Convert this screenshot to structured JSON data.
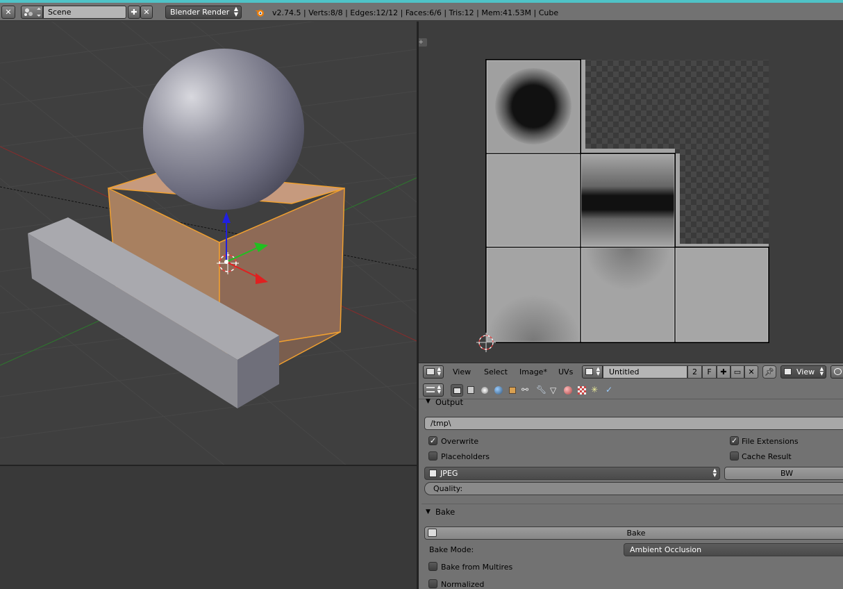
{
  "header": {
    "scene_name": "Scene",
    "render_engine": "Blender Render",
    "info": "v2.74.5 | Verts:8/8 | Edges:12/12 | Faces:6/6 | Tris:12 | Mem:41.53M | Cube"
  },
  "uv_editor": {
    "menus": [
      "View",
      "Select",
      "Image*",
      "UVs"
    ],
    "image_name": "Untitled",
    "users_count": "2",
    "fake_user": "F",
    "view_mode": "View"
  },
  "properties": {
    "output": {
      "title": "Output",
      "path": "/tmp\\",
      "overwrite_label": "Overwrite",
      "overwrite_checked": true,
      "file_extensions_label": "File Extensions",
      "file_extensions_checked": true,
      "placeholders_label": "Placeholders",
      "placeholders_checked": false,
      "cache_result_label": "Cache Result",
      "cache_result_checked": false,
      "format": "JPEG",
      "color_mode": "BW",
      "quality_label": "Quality:"
    },
    "bake": {
      "title": "Bake",
      "bake_button": "Bake",
      "bake_mode_label": "Bake Mode:",
      "bake_mode_value": "Ambient Occlusion",
      "multires_label": "Bake from Multires",
      "multires_checked": false,
      "normalized_label": "Normalized",
      "normalized_checked": false
    }
  },
  "colors": {
    "accent_cyan": "#4fc3c7",
    "selection_orange": "#f0a030",
    "header_gray": "#727272",
    "viewport_bg": "#3f3f3f"
  }
}
